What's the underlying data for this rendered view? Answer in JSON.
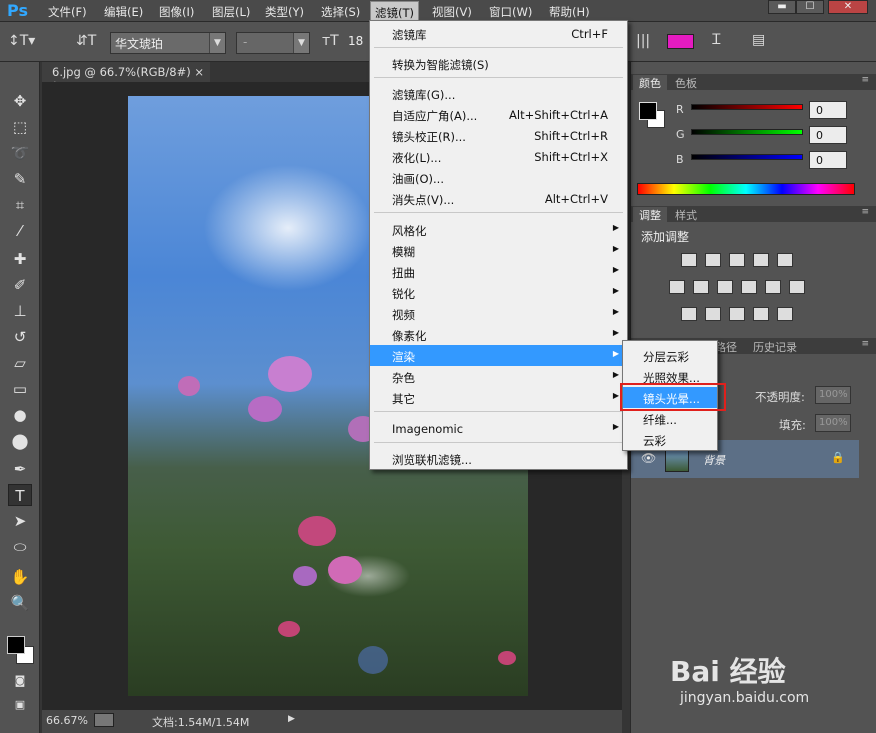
{
  "app": {
    "logo": "Ps"
  },
  "menubar": {
    "items": [
      "文件(F)",
      "编辑(E)",
      "图像(I)",
      "图层(L)",
      "类型(Y)",
      "选择(S)",
      "滤镜(T)",
      "视图(V)",
      "窗口(W)",
      "帮助(H)"
    ],
    "active": "滤镜(T)"
  },
  "options_bar": {
    "font_family": "华文琥珀",
    "font_style": "-",
    "font_size": "18",
    "text_color": "#e51bc1"
  },
  "document": {
    "tab_title": "6.jpg @ 66.7%(RGB/8#) *",
    "tab_close": "×",
    "zoom": "66.67%",
    "doc_info": "文档:1.54M/1.54M"
  },
  "filter_menu": {
    "items": [
      {
        "label": "滤镜库",
        "shortcut": "Ctrl+F"
      },
      {
        "label": "转换为智能滤镜(S)"
      },
      {
        "label": "滤镜库(G)..."
      },
      {
        "label": "自适应广角(A)...",
        "shortcut": "Alt+Shift+Ctrl+A"
      },
      {
        "label": "镜头校正(R)...",
        "shortcut": "Shift+Ctrl+R"
      },
      {
        "label": "液化(L)...",
        "shortcut": "Shift+Ctrl+X"
      },
      {
        "label": "油画(O)..."
      },
      {
        "label": "消失点(V)...",
        "shortcut": "Alt+Ctrl+V"
      },
      {
        "label": "风格化"
      },
      {
        "label": "模糊"
      },
      {
        "label": "扭曲"
      },
      {
        "label": "锐化"
      },
      {
        "label": "视频"
      },
      {
        "label": "像素化"
      },
      {
        "label": "渲染",
        "highlighted": true
      },
      {
        "label": "杂色"
      },
      {
        "label": "其它"
      },
      {
        "label": "Imagenomic"
      },
      {
        "label": "浏览联机滤镜..."
      }
    ],
    "submenu_arrow": "▶"
  },
  "render_submenu": {
    "items": [
      "分层云彩",
      "光照效果...",
      "镜头光晕...",
      "纤维...",
      "云彩"
    ],
    "highlighted": "镜头光晕..."
  },
  "color_panel": {
    "tabs": [
      "颜色",
      "色板"
    ],
    "channels": [
      {
        "label": "R",
        "value": "0"
      },
      {
        "label": "G",
        "value": "0"
      },
      {
        "label": "B",
        "value": "0"
      }
    ]
  },
  "adjust_panel": {
    "tabs": [
      "调整",
      "样式"
    ],
    "title": "添加调整"
  },
  "layers_panel": {
    "tabs": [
      "路径",
      "历史记录"
    ],
    "opacity_label": "不透明度:",
    "opacity_value": "100%",
    "fill_label": "填充:",
    "fill_value": "100%",
    "layer_name": "背景"
  },
  "watermark": {
    "brand": "Bai 经验",
    "url": "jingyan.baidu.com"
  }
}
